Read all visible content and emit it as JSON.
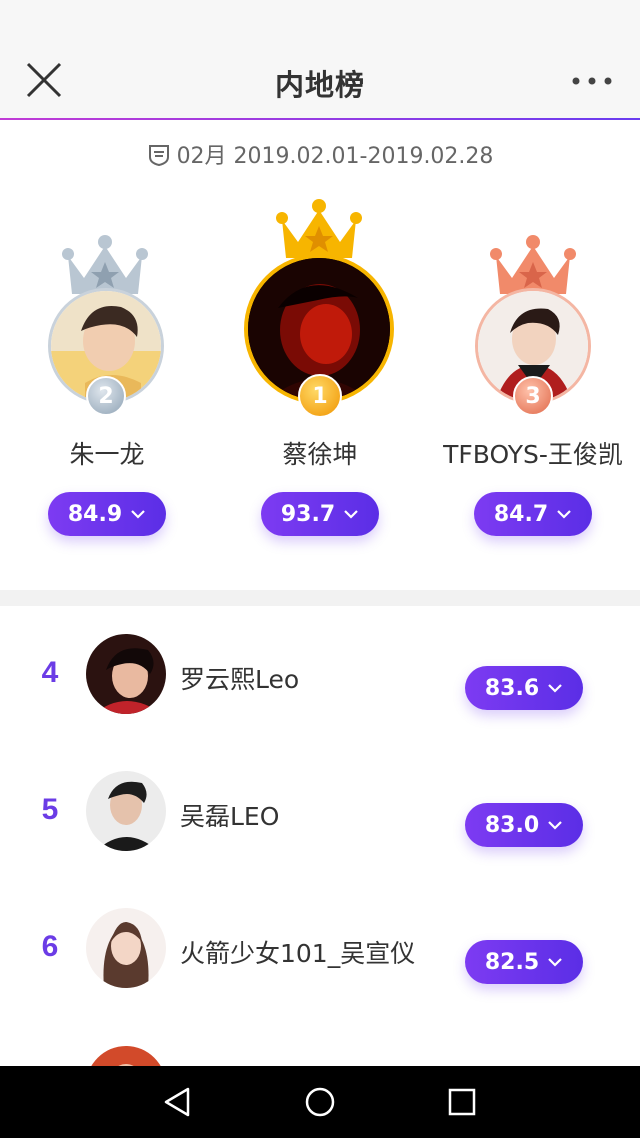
{
  "header": {
    "title": "内地榜"
  },
  "period": {
    "text": "02月 2019.02.01-2019.02.28"
  },
  "podium": [
    {
      "rank": "2",
      "name": "朱一龙",
      "score": "84.9",
      "crown_color": "#b9c6d2"
    },
    {
      "rank": "1",
      "name": "蔡徐坤",
      "score": "93.7",
      "crown_color": "#f7b500"
    },
    {
      "rank": "3",
      "name": "TFBOYS-王俊凯",
      "score": "84.7",
      "crown_color": "#f18a6a"
    }
  ],
  "list": [
    {
      "rank": "4",
      "name": "罗云熙Leo",
      "score": "83.6"
    },
    {
      "rank": "5",
      "name": "吴磊LEO",
      "score": "83.0"
    },
    {
      "rank": "6",
      "name": "火箭少女101_吴宣仪",
      "score": "82.5"
    }
  ],
  "colors": {
    "accent": "#6b3ce6",
    "gold": "#f7b500",
    "silver": "#b9c6d2",
    "bronze": "#f18a6a"
  }
}
